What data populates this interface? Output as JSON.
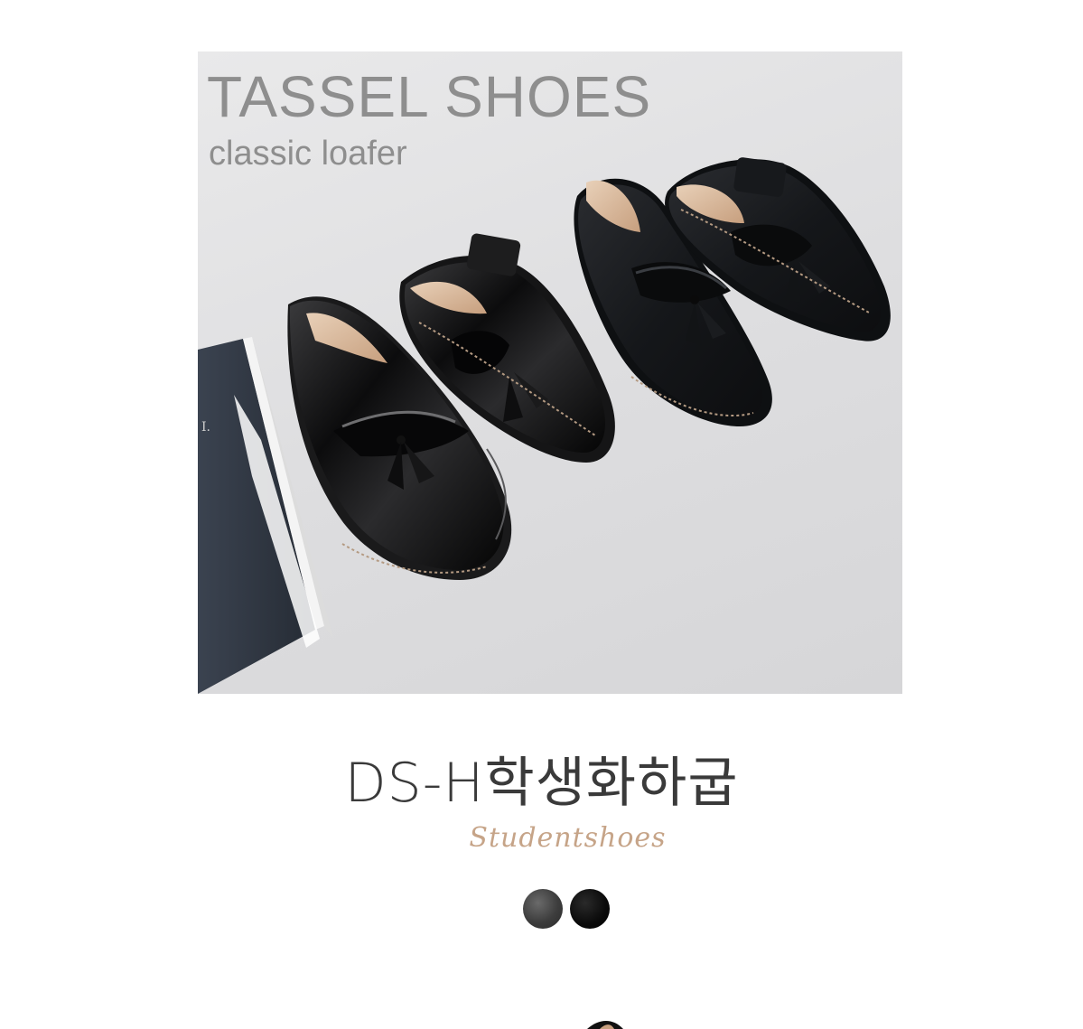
{
  "hero": {
    "title": "TASSEL SHOES",
    "subtitle": "classic loafer"
  },
  "product": {
    "name": "DS-H학생화하굽",
    "subtitle": "Studentshoes"
  },
  "color_swatches": [
    {
      "name": "grey-leather",
      "color": "#3d3d3d"
    },
    {
      "name": "black",
      "color": "#0a0a0a"
    }
  ],
  "colors": {
    "title_grey": "#8e8e8e",
    "script_tan": "#c6a488",
    "name_dark": "#3a3a3a"
  }
}
